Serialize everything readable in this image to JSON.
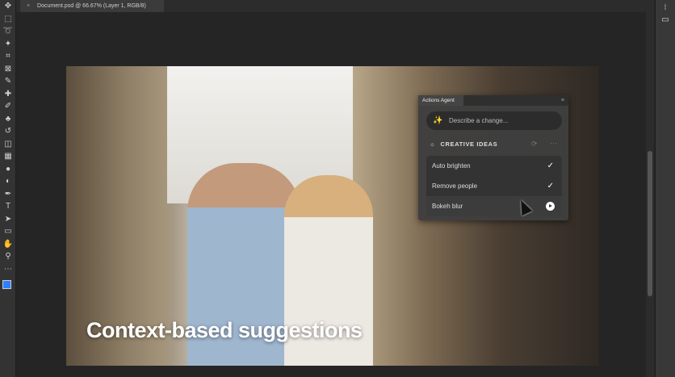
{
  "document_tab": {
    "title": "Document.psd @ 66.67% (Layer 1, RGB/8)",
    "close_icon": "×"
  },
  "toolbar": [
    "move",
    "marquee",
    "lasso",
    "magic-wand",
    "crop",
    "frame",
    "eyedropper",
    "healing",
    "brush",
    "stamp",
    "history-brush",
    "eraser",
    "gradient",
    "blur",
    "dodge",
    "pen",
    "type",
    "path-select",
    "shape",
    "hand",
    "zoom",
    "more"
  ],
  "toolbar_glyphs": [
    "✥",
    "⬚",
    "➰",
    "✦",
    "⌗",
    "⊠",
    "✎",
    "✚",
    "✐",
    "♣",
    "↺",
    "◫",
    "▦",
    "●",
    "◐",
    "✒",
    "T",
    "➤",
    "▭",
    "✋",
    "⚲",
    "⋯"
  ],
  "canvas": {
    "caption": "Context-based suggestions"
  },
  "actions_panel": {
    "title": "Actions Agent",
    "prompt_placeholder": "Describe a change...",
    "section_title": "CREATIVE IDEAS",
    "items": [
      {
        "label": "Auto brighten",
        "status": "✓"
      },
      {
        "label": "Remove people",
        "status": "✓"
      },
      {
        "label": "Bokeh blur",
        "status": "play"
      }
    ]
  }
}
